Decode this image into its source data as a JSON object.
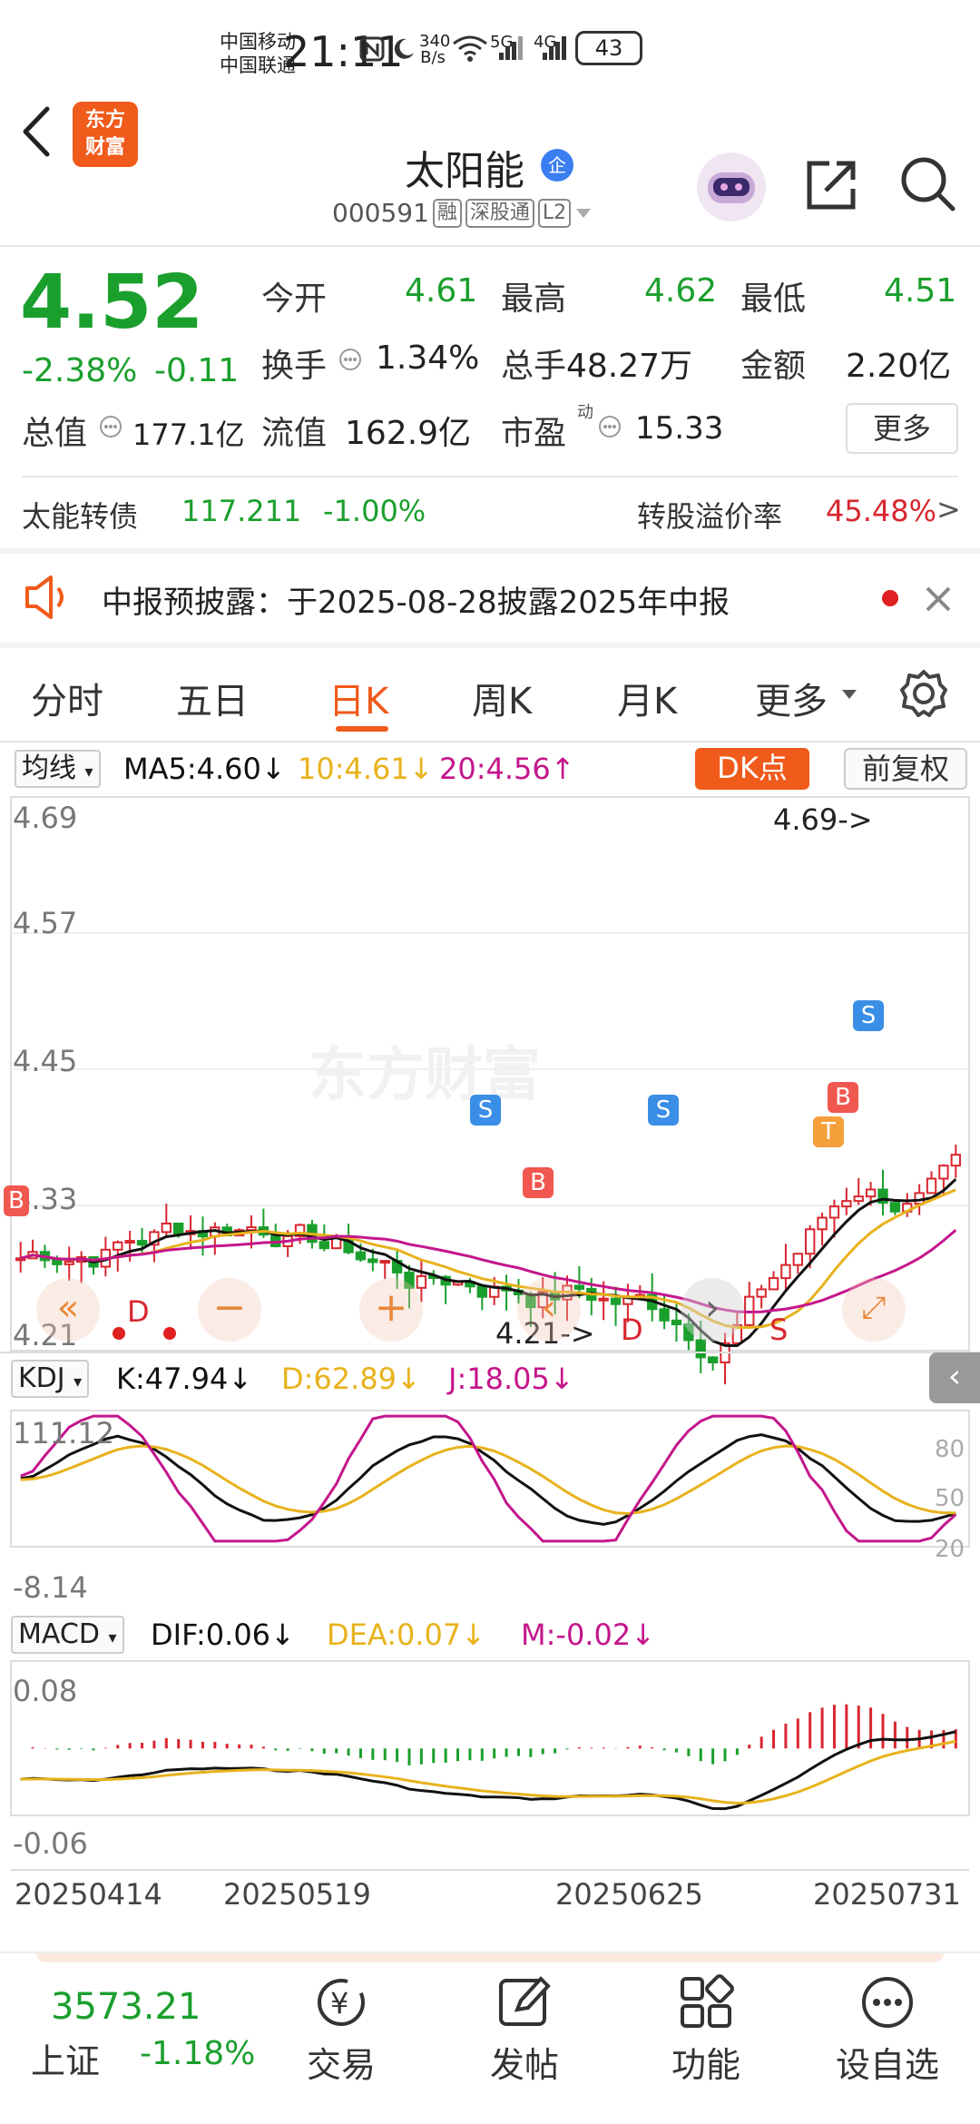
{
  "status_bar": {
    "carrier1": "中国移动",
    "carrier2": "中国联通",
    "time": "21:11",
    "speed_value": "340",
    "speed_unit": "B/s",
    "net1": "5G",
    "net2": "4G",
    "battery": "43"
  },
  "header": {
    "logo_line1": "东方",
    "logo_line2": "财富",
    "title": "太阳能",
    "title_badge": "企",
    "code": "000591",
    "tags": [
      "融",
      "深股通",
      "L2"
    ]
  },
  "quote": {
    "price": "4.52",
    "change_pct": "-2.38%",
    "change_abs": "-0.11",
    "open_label": "今开",
    "open": "4.61",
    "high_label": "最高",
    "high": "4.62",
    "low_label": "最低",
    "low": "4.51",
    "turnover_label": "换手",
    "turnover": "1.34%",
    "volume_label": "总手",
    "volume": "48.27万",
    "amount_label": "金额",
    "amount": "2.20亿",
    "mktcap_label": "总值",
    "mktcap": "177.1亿",
    "float_label": "流值",
    "float_cap": "162.9亿",
    "pe_label": "市盈",
    "pe_sup": "动",
    "pe": "15.33",
    "more": "更多"
  },
  "bond": {
    "name": "太能转债",
    "price": "117.211",
    "change": "-1.00%",
    "premium_label": "转股溢价率",
    "premium": "45.48%",
    "arrow": ">"
  },
  "notice": {
    "text": "中报预披露：于2025-08-28披露2025年中报"
  },
  "tabs": [
    "分时",
    "五日",
    "日K",
    "周K",
    "月K",
    "更多"
  ],
  "active_tab": "日K",
  "kline": {
    "indicator": "均线",
    "ma5": "MA5:4.60",
    "ma10": "10:4.61",
    "ma20": "20:4.56",
    "dk_btn": "DK点",
    "fq_btn": "前复权",
    "y_labels": [
      "4.69",
      "4.57",
      "4.45",
      "4.33",
      "4.21"
    ],
    "high_mark": "4.69->",
    "low_mark": "4.21->",
    "watermark": "东方财富",
    "markers": [
      "S",
      "B",
      "S",
      "S",
      "B",
      "T",
      "B",
      "D",
      "D",
      "S"
    ]
  },
  "kdj": {
    "indicator": "KDJ",
    "k": "K:47.94",
    "d": "D:62.89",
    "j": "J:18.05",
    "y_top": "111.12",
    "y_bottom": "-8.14",
    "r80": "80",
    "r50": "50",
    "r20": "20"
  },
  "macd": {
    "indicator": "MACD",
    "dif": "DIF:0.06",
    "dea": "DEA:0.07",
    "m": "M:-0.02",
    "y_top": "0.08",
    "y_bottom": "-0.06"
  },
  "dates": [
    "20250414",
    "20250519",
    "20250625",
    "20250731"
  ],
  "bottom_nav": {
    "index_value": "3573.21",
    "index_name": "上证",
    "index_change": "-1.18%",
    "items": [
      "交易",
      "发帖",
      "功能",
      "设自选"
    ]
  },
  "colors": {
    "up": "#d8262e",
    "down": "#1a9f2d",
    "accent": "#f05a1a",
    "ma5": "#111111",
    "ma10": "#e8b21c",
    "ma20": "#c4168c"
  }
}
